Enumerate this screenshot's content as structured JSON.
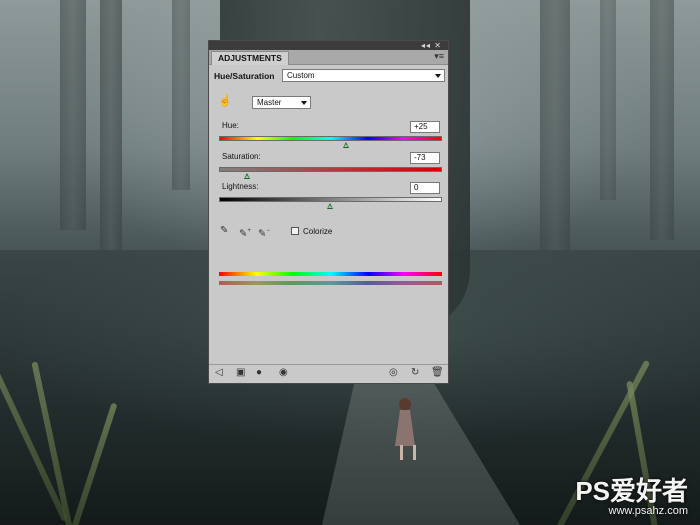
{
  "panel": {
    "tab_label": "ADJUSTMENTS",
    "title": "Hue/Saturation",
    "preset": {
      "value": "Custom"
    },
    "channel": {
      "value": "Master"
    },
    "hue": {
      "label": "Hue:",
      "value": "+25",
      "level": 0.57
    },
    "saturation": {
      "label": "Saturation:",
      "value": "-73",
      "level": 0.13
    },
    "lightness": {
      "label": "Lightness:",
      "value": "0",
      "level": 0.5
    },
    "colorize": {
      "label": "Colorize",
      "checked": false
    }
  },
  "icons": {
    "target_adjust": "hand-tool-icon",
    "eyedropper": "eyedropper-icon",
    "eyedropper_add": "eyedropper-plus-icon",
    "eyedropper_subtract": "eyedropper-minus-icon",
    "panel_menu": "panel-menu-icon",
    "back": "return-arrow-icon",
    "clip": "clip-to-layer-icon",
    "visibility": "visibility-icon",
    "view_previous": "view-previous-icon",
    "reset": "reset-icon",
    "delete": "trash-icon"
  },
  "watermark": {
    "main": "PS爱好者",
    "sub": "www.psahz.com"
  }
}
